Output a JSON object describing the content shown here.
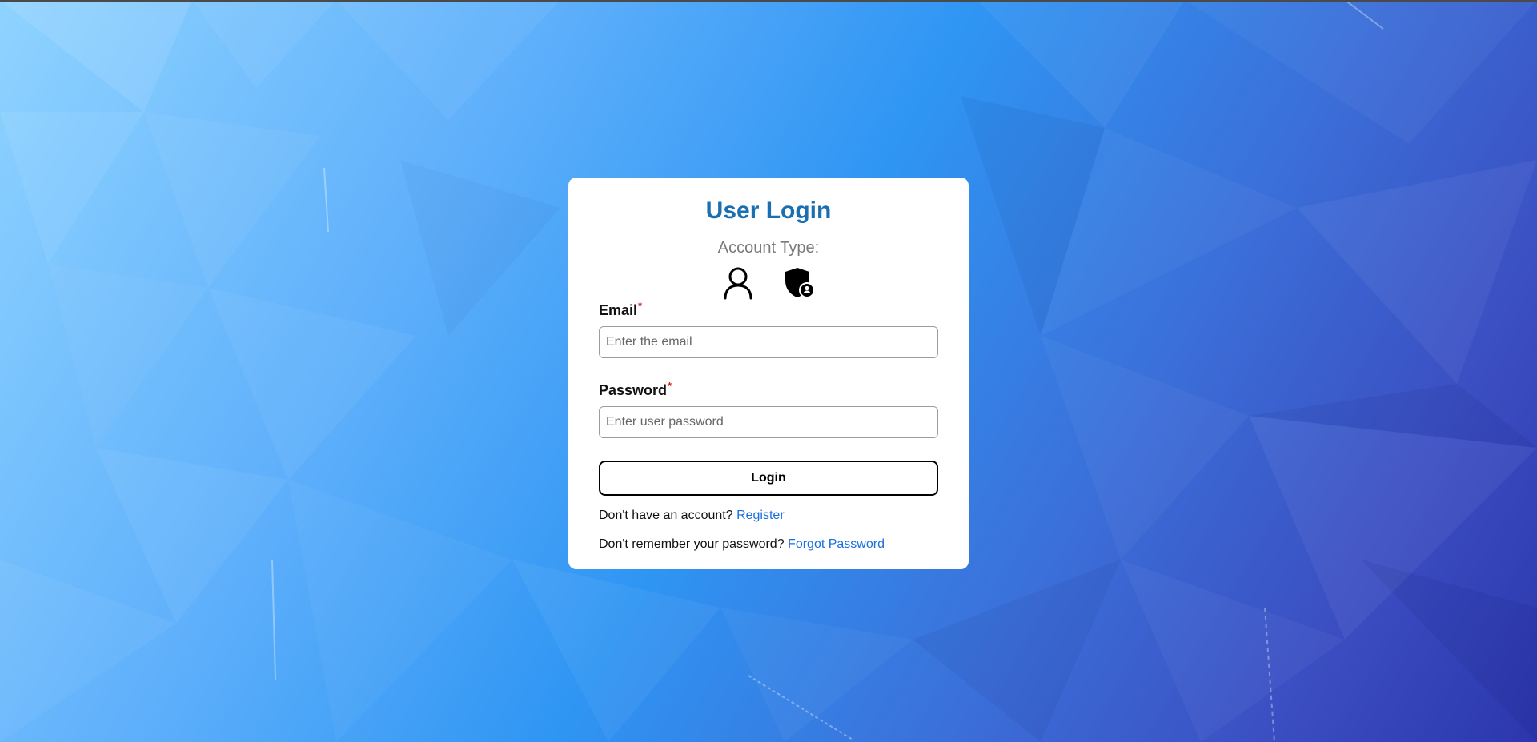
{
  "colors": {
    "title": "#1a6fb1",
    "link": "#1a6fe0",
    "required": "#d0201c",
    "card": "#ffffff"
  },
  "login": {
    "title": "User Login",
    "account_type_label": "Account Type:",
    "account_types": [
      {
        "icon": "user-icon"
      },
      {
        "icon": "admin-shield-icon"
      }
    ],
    "email": {
      "label": "Email",
      "required_mark": "*",
      "placeholder": "Enter the email",
      "value": ""
    },
    "password": {
      "label": "Password",
      "required_mark": "*",
      "placeholder": "Enter user password",
      "value": ""
    },
    "submit_label": "Login",
    "register_prompt": "Don't have an account?",
    "register_link": "Register",
    "forgot_prompt": "Don't remember your password?",
    "forgot_link": "Forgot Password"
  }
}
